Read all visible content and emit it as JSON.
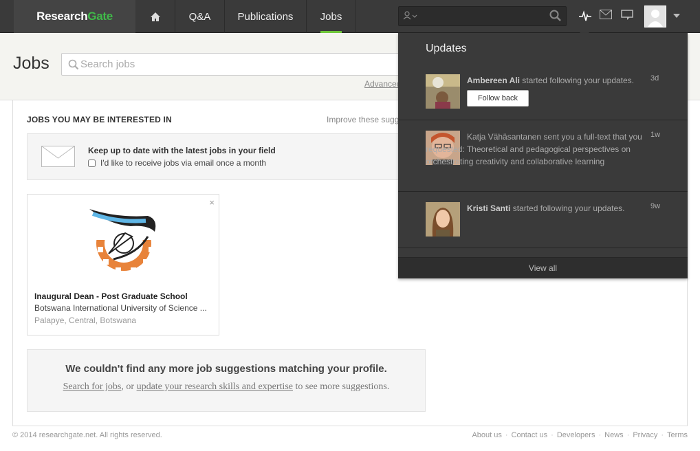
{
  "nav": {
    "logo": "ResearchGate",
    "logo_research": "Research",
    "logo_gate": "Gate",
    "items": [
      {
        "label": "Q&A"
      },
      {
        "label": "Publications"
      },
      {
        "label": "Jobs",
        "active": true
      }
    ],
    "accent_color": "#6fc73b"
  },
  "header": {
    "title": "Jobs",
    "search_placeholder": "Search jobs",
    "advanced_link": "Advanced"
  },
  "section": {
    "title": "JOBS YOU MAY BE INTERESTED IN",
    "improve_link": "Improve these sugg"
  },
  "email_box": {
    "title": "Keep up to date with the latest jobs in your field",
    "checkbox_label": "I'd like to receive jobs via email once a month"
  },
  "job": {
    "title": "Inaugural Dean - Post Graduate School",
    "org": "Botswana International University of Science ...",
    "location": "Palapye, Central, Botswana",
    "close": "×"
  },
  "no_more": {
    "heading": "We couldn't find any more job suggestions matching your profile.",
    "link1": "Search for jobs",
    "mid": ", or ",
    "link2": "update your research skills and expertise",
    "tail": " to see more suggestions."
  },
  "footer": {
    "copyright": "© 2014 researchgate.net. All rights reserved.",
    "links": [
      "About us",
      "Contact us",
      "Developers",
      "News",
      "Privacy",
      "Terms"
    ]
  },
  "updates": {
    "title": "Updates",
    "items": [
      {
        "name": "Ambereen Ali",
        "text": " started following your updates.",
        "time": "3d",
        "button": "Follow back"
      },
      {
        "name": "",
        "text": "Katja Vähäsantanen sent you a full-text that you requested: Theoretical and pedagogical perspectives on orchestrating creativity and collaborative learning",
        "time": "1w"
      },
      {
        "name": "Kristi Santi",
        "text": " started following your updates.",
        "time": "9w"
      }
    ],
    "view_all": "View all"
  }
}
